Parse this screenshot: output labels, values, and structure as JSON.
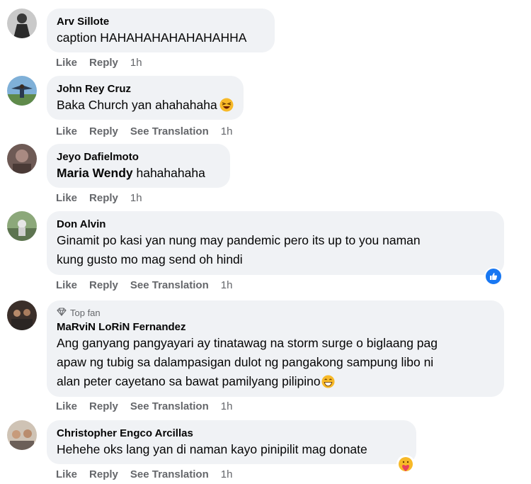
{
  "comments": [
    {
      "name": "Arv Sillote",
      "text": "caption HAHAHAHAHAHAHAHHA",
      "actions": {
        "like": "Like",
        "reply": "Reply",
        "time": "1h"
      }
    },
    {
      "name": "John Rey Cruz",
      "text": "Baka Church yan ahahahaha",
      "emoji": "laughing-emoji",
      "actions": {
        "like": "Like",
        "reply": "Reply",
        "translate": "See Translation",
        "time": "1h"
      }
    },
    {
      "name": "Jeyo Dafielmoto",
      "mention": "Maria Wendy",
      "text": " hahahahaha",
      "actions": {
        "like": "Like",
        "reply": "Reply",
        "time": "1h"
      }
    },
    {
      "name": "Don Alvin",
      "text_lines": [
        "Ginamit po kasi yan nung may pandemic pero its up to you naman",
        "kung gusto mo mag send oh hindi"
      ],
      "reaction": "like-reaction-icon",
      "actions": {
        "like": "Like",
        "reply": "Reply",
        "translate": "See Translation",
        "time": "1h"
      }
    },
    {
      "badge": "Top fan",
      "name": "MaRviN LoRiN Fernandez",
      "text_lines": [
        "Ang ganyang pangyayari ay tinatawag na storm surge o biglaang pag",
        "apaw ng tubig sa dalampasigan dulot ng pangakong sampung libo ni",
        "alan peter cayetano sa bawat pamilyang pilipino"
      ],
      "emoji": "grin-emoji",
      "actions": {
        "like": "Like",
        "reply": "Reply",
        "translate": "See Translation",
        "time": "1h"
      }
    },
    {
      "name": "Christopher Engco Arcillas",
      "text": "Hehehe oks lang yan di naman kayo pinipilit mag donate",
      "reaction": "care-reaction-icon",
      "actions": {
        "like": "Like",
        "reply": "Reply",
        "translate": "See Translation",
        "time": "1h"
      }
    }
  ],
  "colors": {
    "bubble": "#f0f2f5",
    "meta": "#65676b",
    "accent": "#1877f2"
  }
}
